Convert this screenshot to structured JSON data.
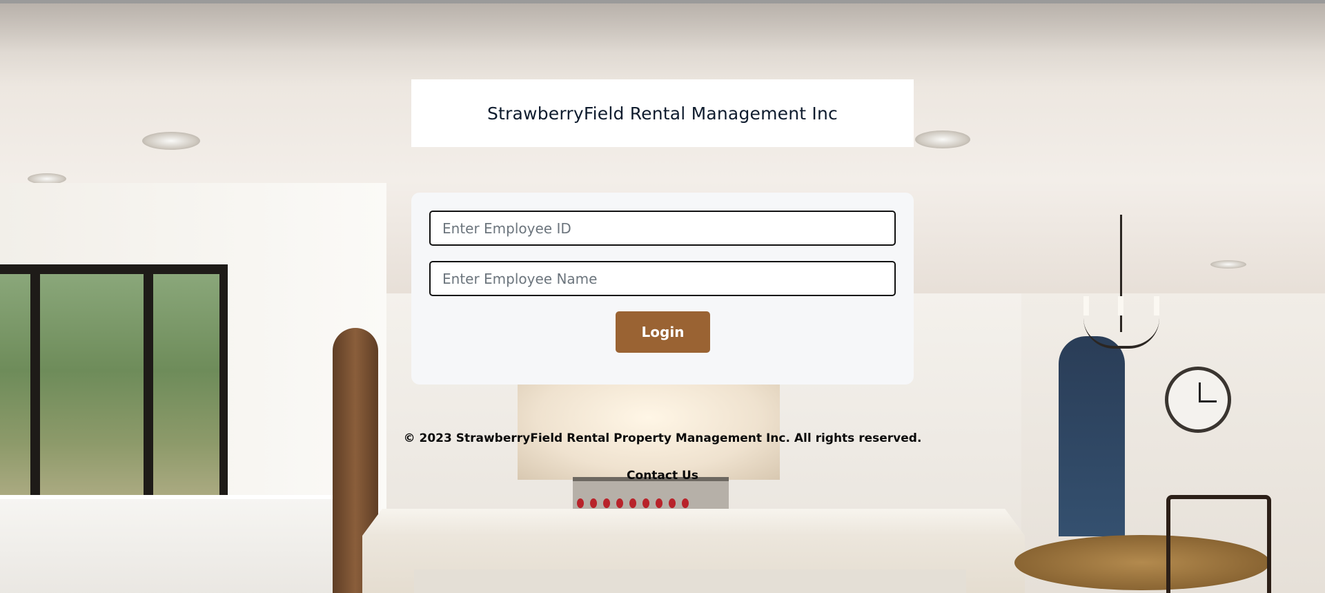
{
  "header": {
    "title": "StrawberryField Rental Management Inc"
  },
  "login_form": {
    "employee_id_placeholder": "Enter Employee ID",
    "employee_id_value": "",
    "employee_name_placeholder": "Enter Employee Name",
    "employee_name_value": "",
    "login_label": "Login"
  },
  "footer": {
    "copyright": "© 2023 StrawberryField Rental Property Management Inc. All rights reserved.",
    "contact_label": "Contact Us"
  },
  "colors": {
    "login_button": "#9a6333",
    "card_background": "#f6f7f9",
    "title_text": "#0f1c2e"
  },
  "background": {
    "description_icon": "kitchen-background-image"
  }
}
